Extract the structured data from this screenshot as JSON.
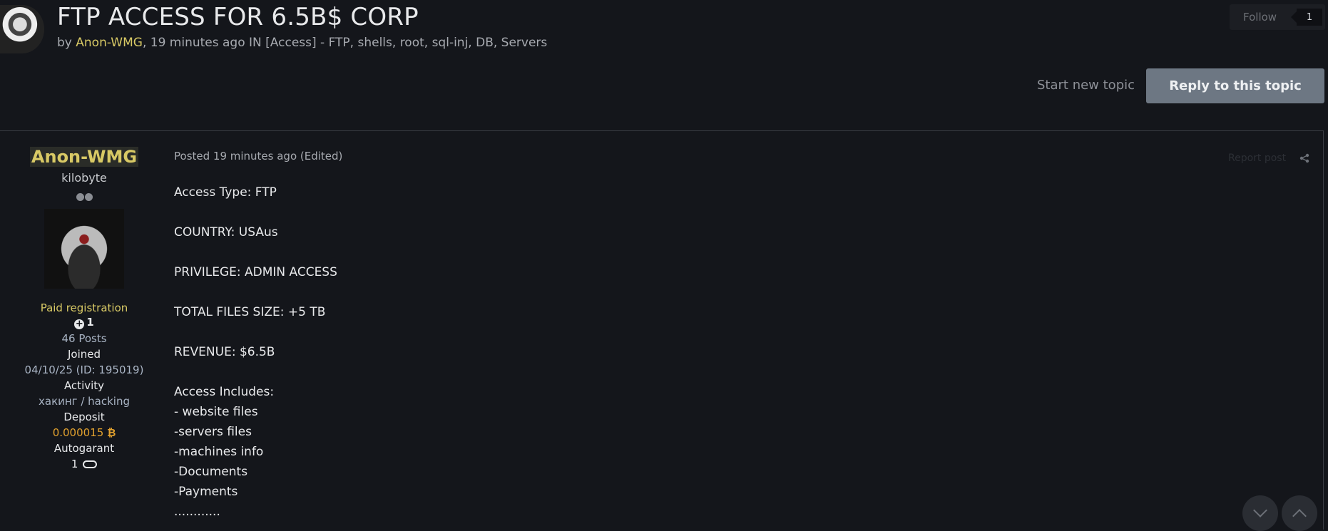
{
  "topic": {
    "title": "FTP ACCESS FOR 6.5B$ CORP",
    "byline_prefix": "by ",
    "author": "Anon-WMG",
    "byline_suffix": ", 19 minutes ago IN [Access] - FTP, shells, root, sql-inj, DB, Servers"
  },
  "follow": {
    "label": "Follow",
    "count": "1"
  },
  "actions": {
    "start_new_topic": "Start new topic",
    "reply": "Reply to this topic"
  },
  "author_panel": {
    "name": "Anon-WMG",
    "rank": "kilobyte",
    "group": "Paid registration",
    "reputation": "1",
    "posts": "46 Posts",
    "joined_label": "Joined",
    "joined_value": "04/10/25 (ID: 195019)",
    "activity_label": "Activity",
    "activity_value": "хакинг / hacking",
    "deposit_label": "Deposit",
    "deposit_value": "0.000015",
    "autogarant_label": "Autogarant",
    "autogarant_value": "1"
  },
  "post": {
    "meta": "Posted 19 minutes ago (Edited)",
    "report": "Report post",
    "lines": [
      "Access Type: FTP",
      "",
      "COUNTRY: USAus",
      "",
      "PRIVILEGE: ADMIN ACCESS",
      "",
      "TOTAL FILES SIZE: +5 TB",
      "",
      "REVENUE: $6.5B",
      "",
      "Access Includes:",
      "- website files",
      "-servers files",
      "-machines info",
      "-Documents",
      "-Payments",
      "............"
    ]
  }
}
